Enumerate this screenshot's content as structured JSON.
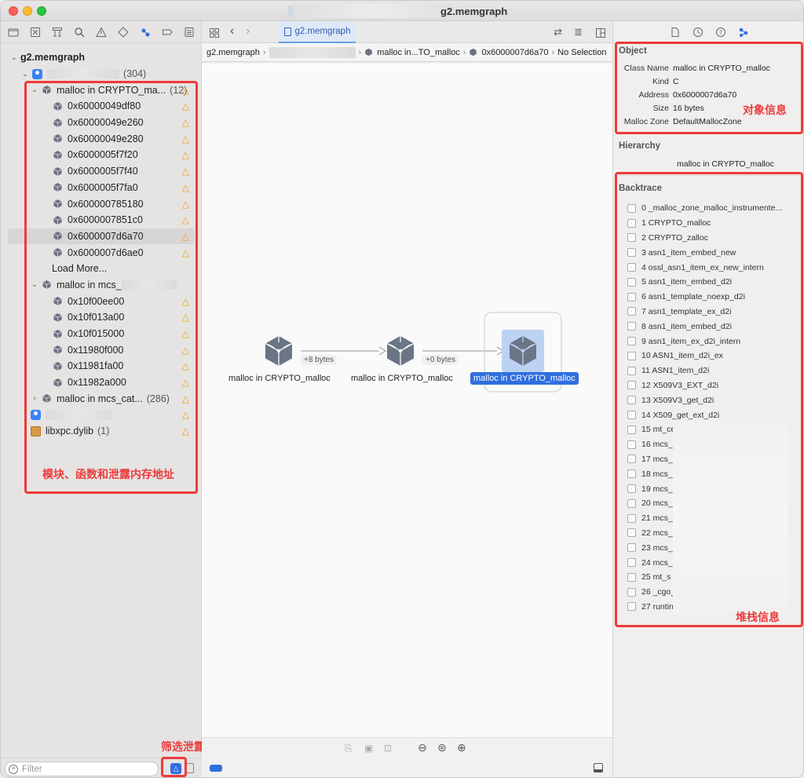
{
  "window": {
    "title": "g2.memgraph"
  },
  "sidebar": {
    "root": "g2.memgraph",
    "process": {
      "count": "(304)"
    },
    "groups": [
      {
        "label": "malloc in CRYPTO_ma...",
        "count": "(12)",
        "items": [
          "0x60000049df80",
          "0x60000049e260",
          "0x60000049e280",
          "0x6000005f7f20",
          "0x6000005f7f40",
          "0x6000005f7fa0",
          "0x600000785180",
          "0x6000007851c0",
          "0x6000007d6a70",
          "0x6000007d6ae0"
        ],
        "load_more": "Load More..."
      },
      {
        "label": "malloc in mcs_",
        "items": [
          "0x10f00ee00",
          "0x10f013a00",
          "0x10f015000",
          "0x11980f000",
          "0x11981fa00",
          "0x11982a000"
        ]
      },
      {
        "label": "malloc in mcs_cat...",
        "count": "(286)"
      }
    ],
    "libxpc": {
      "label": "libxpc.dylib",
      "count": "(1)"
    },
    "annotation": "模块、函数和泄露内存地址",
    "filter_placeholder": "Filter",
    "filter_annotation": "筛选泄露项"
  },
  "editor": {
    "tab_label": "g2.memgraph",
    "jumpbar": {
      "root": "g2.memgraph",
      "node1": "malloc in...TO_malloc",
      "node2": "0x6000007d6a70",
      "tail": "No Selection"
    },
    "graph": {
      "nodes": [
        "malloc in CRYPTO_malloc",
        "malloc in CRYPTO_malloc",
        "malloc in CRYPTO_malloc"
      ],
      "edges": [
        "+8 bytes",
        "+0 bytes"
      ]
    }
  },
  "inspector": {
    "object_title": "Object",
    "fields": [
      {
        "key": "Class Name",
        "value": "malloc in CRYPTO_malloc"
      },
      {
        "key": "Kind",
        "value": "C"
      },
      {
        "key": "Address",
        "value": "0x6000007d6a70"
      },
      {
        "key": "Size",
        "value": "16 bytes"
      },
      {
        "key": "Malloc Zone",
        "value": "DefaultMallocZone"
      }
    ],
    "object_annotation": "对象信息",
    "hierarchy_title": "Hierarchy",
    "hierarchy_value": "malloc in CRYPTO_malloc",
    "backtrace_title": "Backtrace",
    "backtrace": [
      "0 _malloc_zone_malloc_instrumente...",
      "1 CRYPTO_malloc",
      "2 CRYPTO_zalloc",
      "3 asn1_item_embed_new",
      "4 ossl_asn1_item_ex_new_intern",
      "5 asn1_item_embed_d2i",
      "6 asn1_template_noexp_d2i",
      "7 asn1_template_ex_d2i",
      "8 asn1_item_embed_d2i",
      "9 asn1_item_ex_d2i_intern",
      "10 ASN1_item_d2i_ex",
      "11 ASN1_item_d2i",
      "12 X509V3_EXT_d2i",
      "13 X509V3_get_d2i",
      "14 X509_get_ext_d2i",
      "15 mt_ce",
      "16 mcs_",
      "17 mcs_",
      "18 mcs_",
      "19 mcs_",
      "20 mcs_",
      "21 mcs_",
      "22 mcs_",
      "23 mcs_",
      "24 mcs_",
      "25 mt_s",
      "26 _cgo_",
      "27 runtin"
    ],
    "backtrace_annotation": "堆栈信息"
  }
}
